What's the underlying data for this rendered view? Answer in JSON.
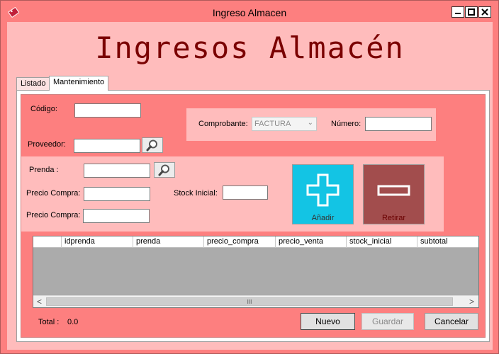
{
  "window": {
    "title": "Ingreso Almacen",
    "minimize": "▬",
    "maximize": "▢",
    "close": "✕"
  },
  "heading": "Ingresos Almacén",
  "tabs": [
    {
      "label": "Listado"
    },
    {
      "label": "Mantenimiento"
    }
  ],
  "form": {
    "codigo_label": "Código:",
    "codigo_value": "",
    "proveedor_label": "Proveedor:",
    "proveedor_value": "",
    "comprobante_label": "Comprobante:",
    "comprobante_value": "FACTURA",
    "numero_label": "Número:",
    "numero_value": "",
    "prenda_label": "Prenda :",
    "prenda_value": "",
    "precio_compra_label": "Precio Compra:",
    "precio_compra_value": "",
    "precio_compra2_label": "Precio Compra:",
    "precio_compra2_value": "",
    "stock_label": "Stock Inicial:",
    "stock_value": ""
  },
  "actions": {
    "add_label": "Añadir",
    "remove_label": "Retirar",
    "add_color": "#13c4e4",
    "remove_color": "#a24d4d"
  },
  "grid": {
    "columns": [
      "idprenda",
      "prenda",
      "precio_compra",
      "precio_venta",
      "stock_inicial",
      "subtotal"
    ],
    "scroll_left": "<",
    "scroll_right": ">",
    "scroll_thumb": "III"
  },
  "footer": {
    "total_label": "Total :",
    "total_value": "0.0",
    "nuevo_label": "Nuevo",
    "guardar_label": "Guardar",
    "cancelar_label": "Cancelar"
  }
}
